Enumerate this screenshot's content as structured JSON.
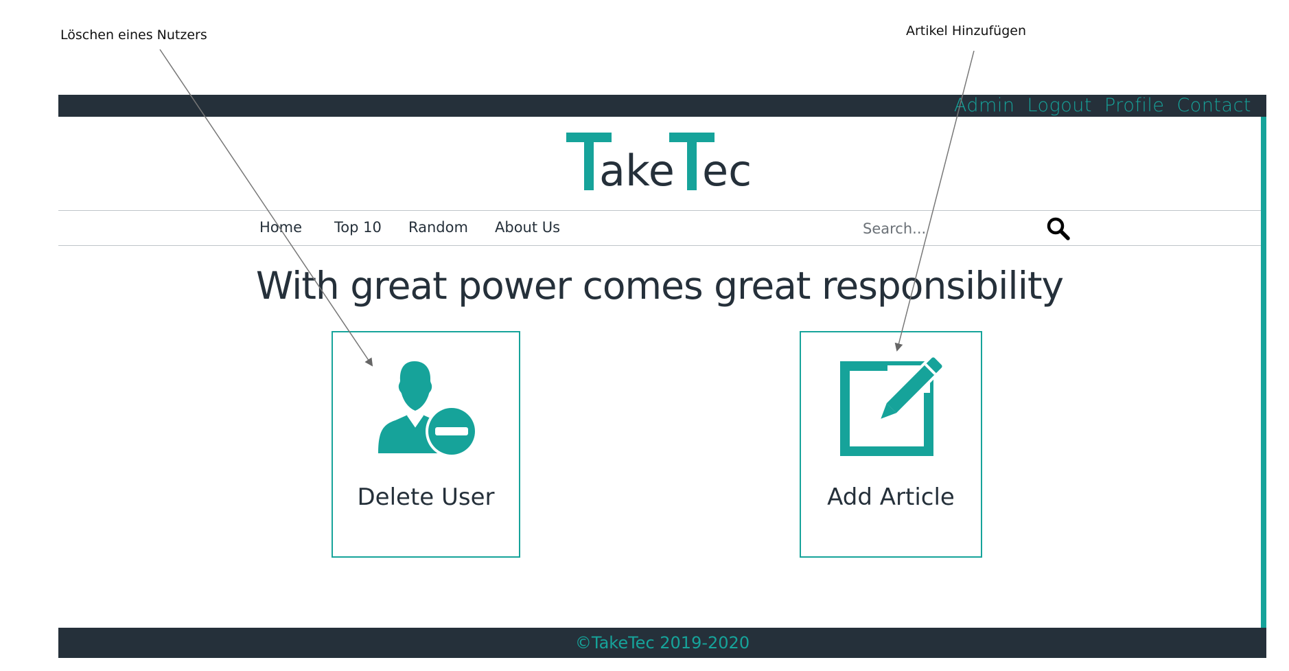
{
  "annotations": {
    "left": "Löschen eines Nutzers",
    "right": "Artikel Hinzufügen"
  },
  "topbar": {
    "links": [
      "Admin",
      "Logout",
      "Profile",
      "Contact"
    ]
  },
  "logo": {
    "part1": "T",
    "part2": "ake",
    "part3": "T",
    "part4": "ec"
  },
  "nav": {
    "items": [
      "Home",
      "Top 10",
      "Random",
      "About Us"
    ],
    "search_placeholder": "Search..."
  },
  "headline": "With great power comes great responsibility",
  "cards": {
    "delete_user": {
      "label": "Delete User",
      "icon": "user-minus-icon"
    },
    "add_article": {
      "label": "Add Article",
      "icon": "edit-icon"
    }
  },
  "footer": {
    "text": "©TakeTec 2019-2020"
  },
  "colors": {
    "accent": "#16a39a",
    "dark": "#25303a"
  }
}
